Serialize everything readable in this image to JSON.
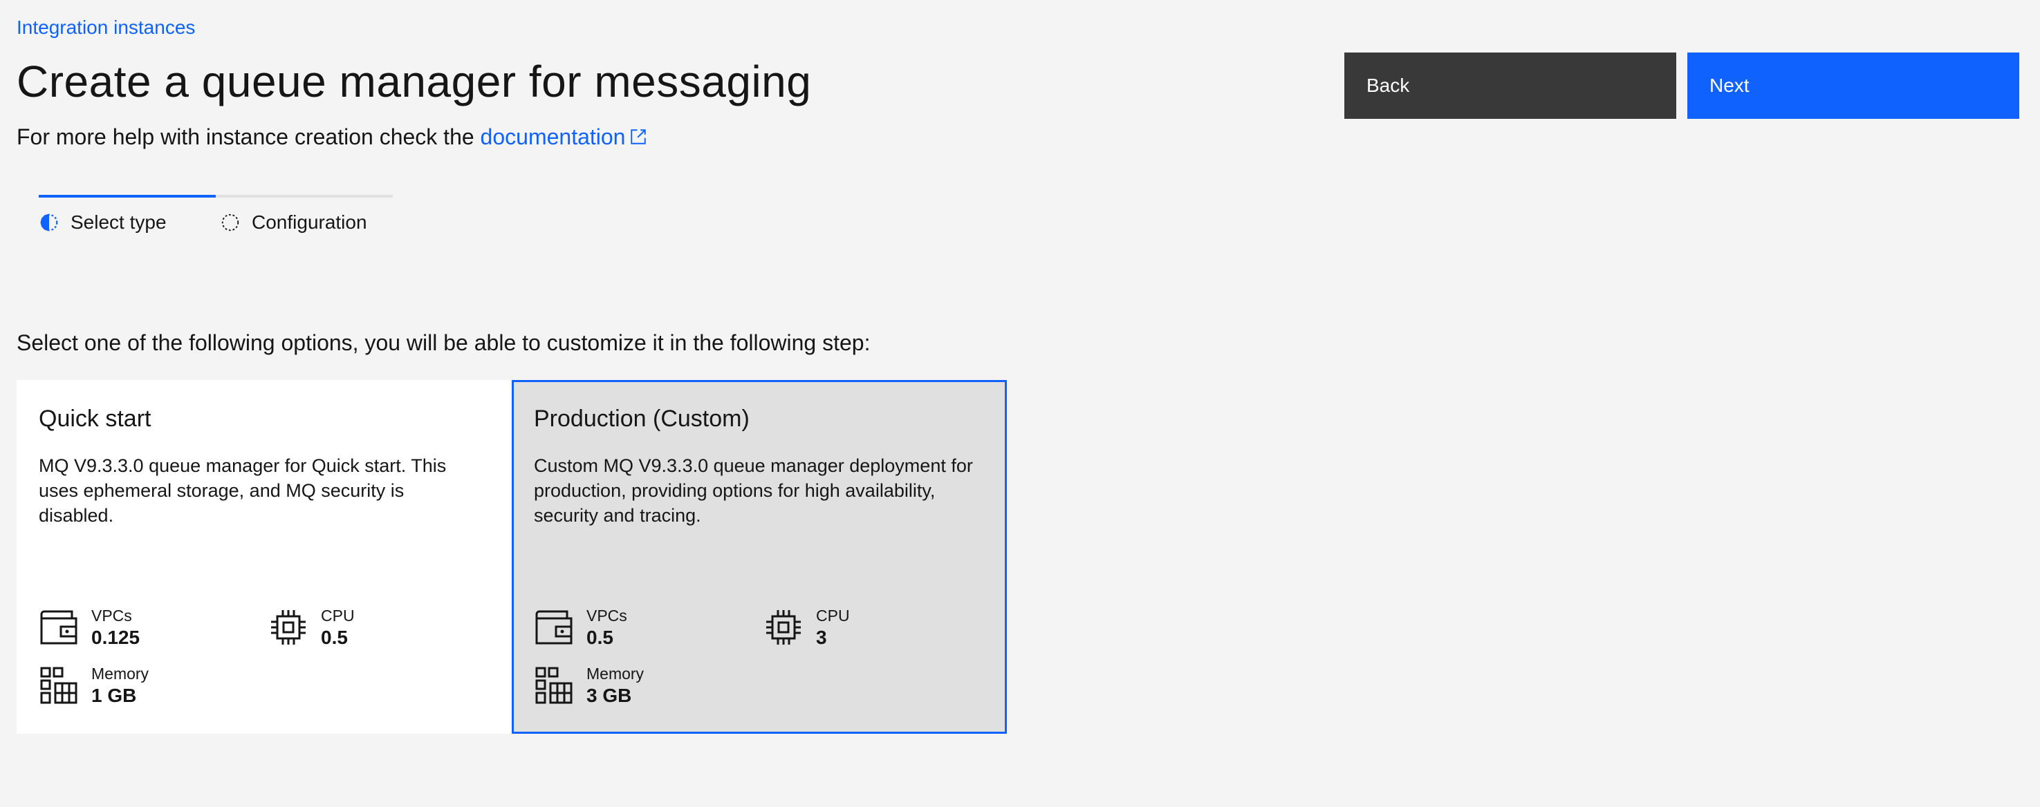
{
  "breadcrumb": "Integration instances",
  "title": "Create a queue manager for messaging",
  "help": {
    "prefix": "For more help with instance creation check the ",
    "link": "documentation"
  },
  "buttons": {
    "back": "Back",
    "next": "Next"
  },
  "steps": [
    {
      "label": "Select type",
      "state": "current"
    },
    {
      "label": "Configuration",
      "state": "incomplete"
    }
  ],
  "instruction": "Select one of the following options, you will be able to customize it in the following step:",
  "tiles": [
    {
      "title": "Quick start",
      "description": "MQ V9.3.3.0 queue manager for Quick start. This uses ephemeral storage, and MQ security is disabled.",
      "selected": false,
      "specs": {
        "vpc_label": "VPCs",
        "vpc_value": "0.125",
        "cpu_label": "CPU",
        "cpu_value": "0.5",
        "memory_label": "Memory",
        "memory_value": "1 GB"
      }
    },
    {
      "title": "Production (Custom)",
      "description": "Custom MQ V9.3.3.0 queue manager deployment for production, providing options for high availability, security and tracing.",
      "selected": true,
      "specs": {
        "vpc_label": "VPCs",
        "vpc_value": "0.5",
        "cpu_label": "CPU",
        "cpu_value": "3",
        "memory_label": "Memory",
        "memory_value": "3 GB"
      }
    }
  ],
  "icons": {
    "external_link": "launch-icon",
    "vpc": "wallet-icon",
    "cpu": "chip-icon",
    "memory": "grid-blocks-icon"
  },
  "colors": {
    "accent": "#0f62fe",
    "background": "#f4f4f4",
    "back_button": "#393939",
    "selected_tile": "#e0e0e0"
  }
}
